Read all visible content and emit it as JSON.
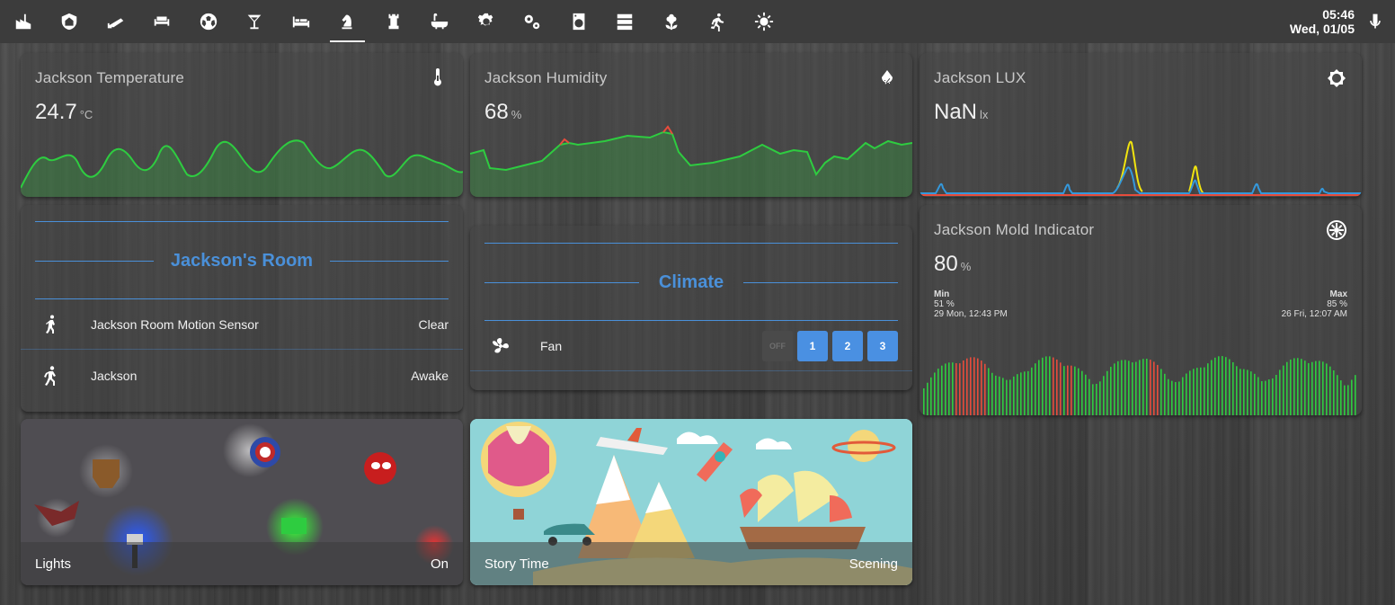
{
  "header": {
    "tabs": [
      {
        "icon": "factory-icon"
      },
      {
        "icon": "home-shield-icon"
      },
      {
        "icon": "cctv-icon"
      },
      {
        "icon": "sofa-icon"
      },
      {
        "icon": "soccer-ball-icon"
      },
      {
        "icon": "martini-glass-icon"
      },
      {
        "icon": "bed-icon"
      },
      {
        "icon": "chess-knight-icon",
        "active": true
      },
      {
        "icon": "chess-rook-icon"
      },
      {
        "icon": "bathtub-icon"
      },
      {
        "icon": "gear-icon"
      },
      {
        "icon": "gears-icon"
      },
      {
        "icon": "washing-machine-icon"
      },
      {
        "icon": "server-icon"
      },
      {
        "icon": "flower-icon"
      },
      {
        "icon": "running-person-icon"
      },
      {
        "icon": "sun-icon"
      }
    ],
    "time": "05:46",
    "date": "Wed, 01/05",
    "mic_icon": "microphone-icon"
  },
  "sensors": {
    "temperature": {
      "title": "Jackson Temperature",
      "value": "24.7",
      "unit": "°C",
      "icon": "thermometer-icon",
      "color": "#2ecc40"
    },
    "humidity": {
      "title": "Jackson Humidity",
      "value": "68",
      "unit": "%",
      "icon": "water-percent-icon",
      "color": "#2ecc40",
      "alert_color": "#e74c3c"
    },
    "lux": {
      "title": "Jackson LUX",
      "value": "NaN",
      "unit": "lx",
      "icon": "brightness-icon",
      "colors": [
        "#e74c3c",
        "#3498db",
        "#f1e40f"
      ]
    },
    "mold": {
      "title": "Jackson Mold Indicator",
      "value": "80",
      "unit": "%",
      "icon": "empire-icon",
      "min_label": "Min",
      "min_value": "51 %",
      "min_time": "29 Mon, 12:43 PM",
      "max_label": "Max",
      "max_value": "85 %",
      "max_time": "26 Fri, 12:07 AM",
      "colors": [
        "#2ecc40",
        "#e74c3c"
      ]
    }
  },
  "room": {
    "title": "Jackson's Room",
    "rows": [
      {
        "icon": "motion-sensor-icon",
        "name": "Jackson Room Motion Sensor",
        "state": "Clear"
      },
      {
        "icon": "walking-person-icon",
        "name": "Jackson",
        "state": "Awake"
      }
    ]
  },
  "climate": {
    "title": "Climate",
    "fan_icon": "fan-icon",
    "fan_name": "Fan",
    "buttons": [
      "OFF",
      "1",
      "2",
      "3"
    ]
  },
  "pictures": {
    "lights": {
      "name": "Lights",
      "state": "On"
    },
    "story": {
      "name": "Story Time",
      "state": "Scening"
    }
  }
}
